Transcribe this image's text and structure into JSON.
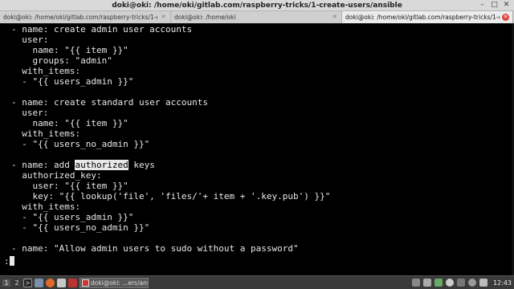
{
  "window": {
    "title": "doki@oki: /home/oki/gitlab.com/raspberry-tricks/1-create-users/ansible"
  },
  "tabs": [
    {
      "label": "doki@oki: /home/oki/gitlab.com/raspberry-tricks/1-crea",
      "active": false
    },
    {
      "label": "doki@oki: /home/oki",
      "active": false
    },
    {
      "label": "doki@oki: /home/oki/gitlab.com/raspberry-tricks/1-crea",
      "active": true
    }
  ],
  "terminal": {
    "lines": [
      "- name: create admin user accounts",
      "  user:",
      "    name: \"{{ item }}\"",
      "    groups: \"admin\"",
      "  with_items:",
      "  - \"{{ users_admin }}\"",
      "",
      "- name: create standard user accounts",
      "  user:",
      "    name: \"{{ item }}\"",
      "  with_items:",
      "  - \"{{ users_no_admin }}\"",
      "",
      "- name: add authorized keys",
      "  authorized_key:",
      "    user: \"{{ item }}\"",
      "    key: \"{{ lookup('file', 'files/'+ item + '.key.pub') }}\"",
      "  with_items:",
      "  - \"{{ users_admin }}\"",
      "  - \"{{ users_no_admin }}\"",
      "",
      "- name: \"Allow admin users to sudo without a password\""
    ],
    "highlight": {
      "line": 13,
      "prefix": "- name: add ",
      "word": "authorized",
      "suffix": " keys"
    },
    "prompt": ":"
  },
  "taskbar": {
    "workspaces": [
      "1",
      "2"
    ],
    "active_workspace": "1",
    "task_label": "doki@oki: ...ers/ansible",
    "clock": "12:43",
    "launcher_icons": [
      "terminal-icon",
      "files-icon",
      "browser-icon",
      "mail-icon",
      "editor-icon"
    ],
    "tray_icons": [
      "network-icon",
      "volume-icon",
      "battery-icon",
      "update-icon",
      "bluetooth-icon",
      "chat-icon",
      "settings-icon"
    ]
  }
}
